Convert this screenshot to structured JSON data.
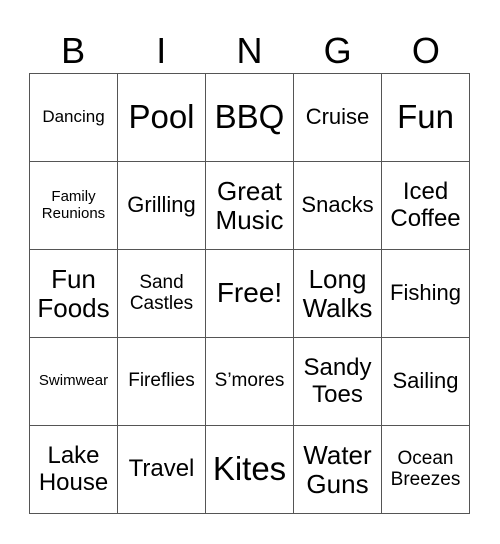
{
  "header": [
    "B",
    "I",
    "N",
    "G",
    "O"
  ],
  "cells": [
    [
      "Dancing",
      "Pool",
      "BBQ",
      "Cruise",
      "Fun"
    ],
    [
      "Family Reunions",
      "Grilling",
      "Great Music",
      "Snacks",
      "Iced Coffee"
    ],
    [
      "Fun Foods",
      "Sand Castles",
      "Free!",
      "Long Walks",
      "Fishing"
    ],
    [
      "Swimwear",
      "Fireflies",
      "S’mores",
      "Sandy Toes",
      "Sailing"
    ],
    [
      "Lake House",
      "Travel",
      "Kites",
      "Water Guns",
      "Ocean Breezes"
    ]
  ]
}
